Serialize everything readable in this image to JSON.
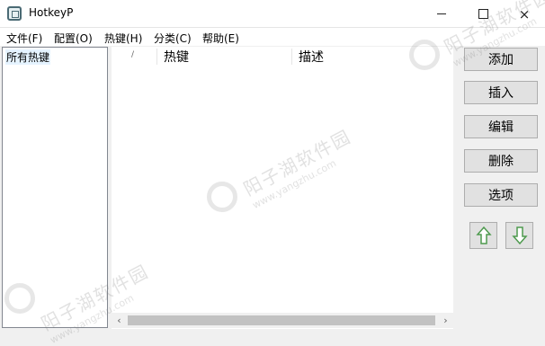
{
  "window": {
    "title": "HotkeyP",
    "minimize": "—",
    "close": "×"
  },
  "menu": [
    {
      "label": "文件(F)"
    },
    {
      "label": "配置(O)"
    },
    {
      "label": "热键(H)"
    },
    {
      "label": "分类(C)"
    },
    {
      "label": "帮助(E)"
    }
  ],
  "tree": {
    "items": [
      {
        "label": "所有热键"
      }
    ]
  },
  "list": {
    "columns": [
      {
        "label": "/"
      },
      {
        "label": "热键"
      },
      {
        "label": "描述"
      }
    ]
  },
  "scrollbar": {
    "left": "‹",
    "right": "›"
  },
  "buttons": [
    {
      "label": "添加"
    },
    {
      "label": "插入"
    },
    {
      "label": "编辑"
    },
    {
      "label": "删除"
    },
    {
      "label": "选项"
    }
  ],
  "watermark": {
    "text": "阳子湖软件园",
    "url": "www.yangzhu.com"
  },
  "icons": {
    "app": "app-icon",
    "up": "arrow-up-icon",
    "down": "arrow-down-icon",
    "arrow_color": "#4e9a4e"
  }
}
